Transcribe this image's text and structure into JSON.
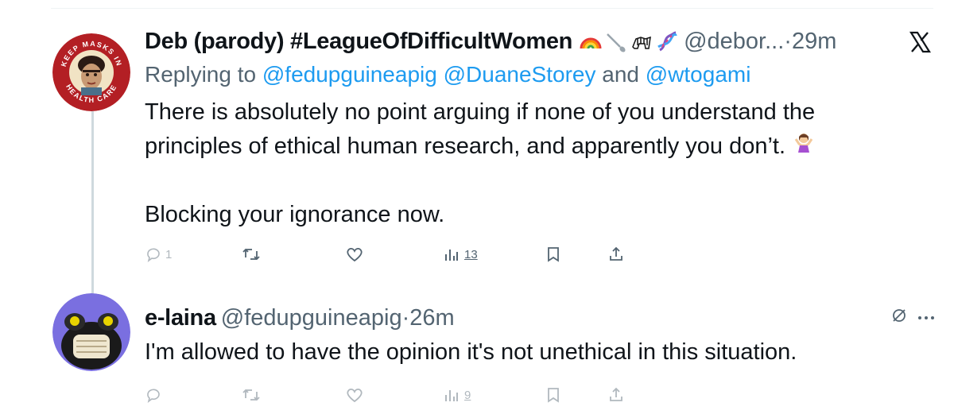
{
  "tweet_1": {
    "name": "Deb (parody) #LeagueOfDifficultWomen",
    "emoji_icons": [
      "rainbow-icon",
      "spoon-icon",
      "zebra-icon",
      "dna-icon"
    ],
    "handle": "@debor...",
    "separator": "·",
    "time": "29m",
    "replying_prefix": "Replying to",
    "replying_mentions": [
      "@fedupguineapig",
      "@DuaneStorey"
    ],
    "replying_and": "and",
    "replying_last": "@wtogami",
    "text_line_1": "There is absolutely no point arguing if none of you understand the",
    "text_line_2": "principles of ethical human research, and apparently you don’t.",
    "text_line_3": "Blocking your ignorance now.",
    "avatar_text_top": "KEEP MASKS IN",
    "avatar_text_bottom": "HEALTH CARE",
    "actions": {
      "replies": "1",
      "views": "13"
    }
  },
  "tweet_2": {
    "name": "e-laina",
    "handle": "@fedupguineapig",
    "separator": "·",
    "time": "26m",
    "text_line_1": "I'm allowed to have the opinion it's not unethical in this situation.",
    "actions": {
      "views": "9"
    }
  },
  "colors": {
    "link": "#1d9bf0",
    "secondary_text": "#536471",
    "primary_text": "#0f1419",
    "thread_line": "#cfd9de"
  }
}
